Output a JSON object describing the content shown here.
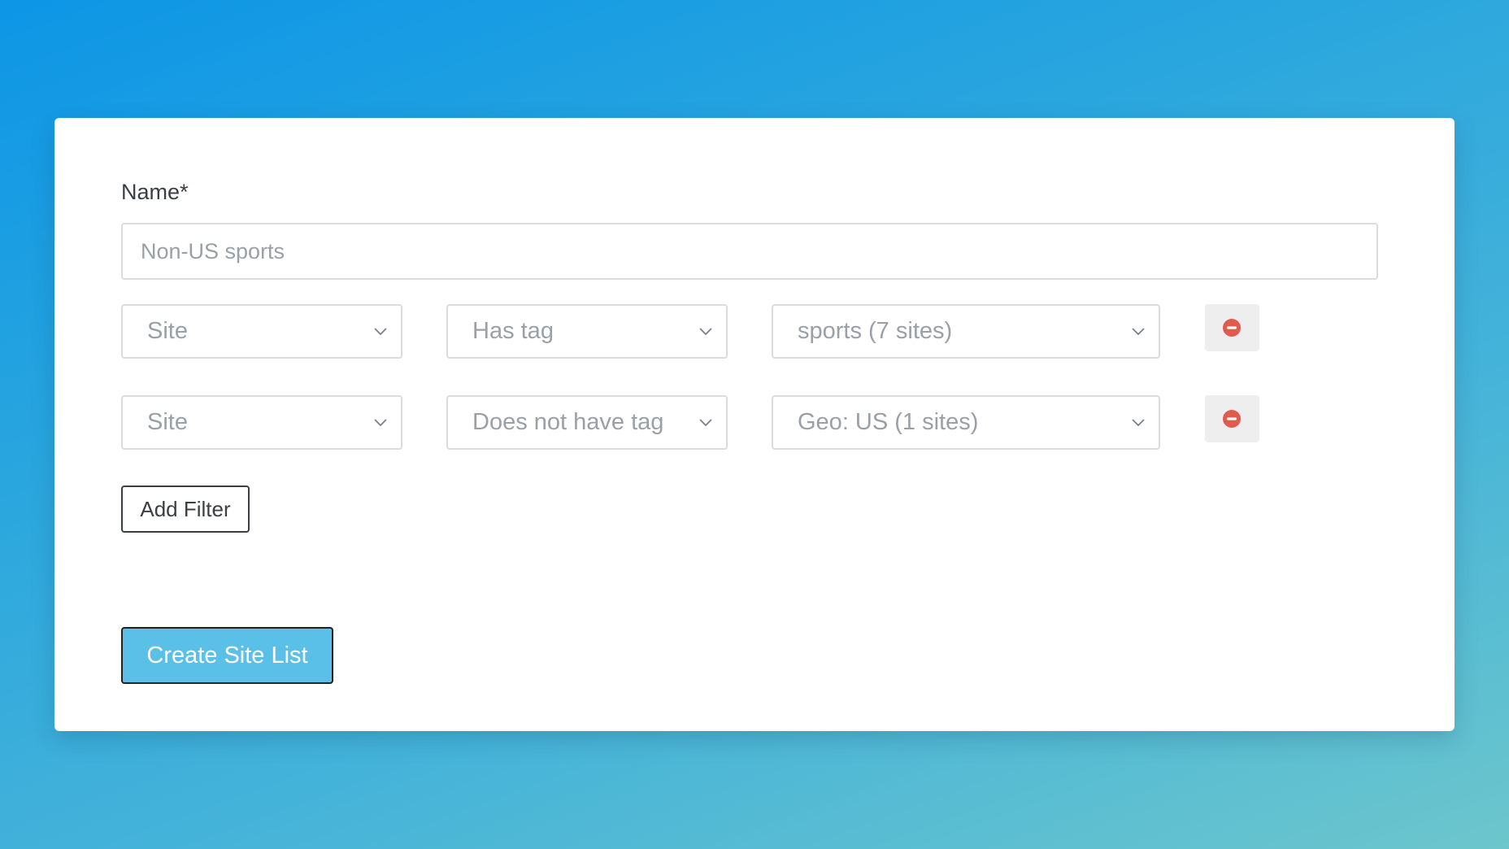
{
  "form": {
    "name_label": "Name*",
    "name_placeholder": "Non-US sports",
    "name_value": ""
  },
  "filters": [
    {
      "field": "Site",
      "operator": "Has tag",
      "tag": "sports (7 sites)"
    },
    {
      "field": "Site",
      "operator": "Does not have tag",
      "tag": "Geo: US (1 sites)"
    }
  ],
  "buttons": {
    "add_filter": "Add Filter",
    "create": "Create Site List"
  },
  "icons": {
    "remove": "minus-circle-icon",
    "dropdown": "chevron-down-icon"
  },
  "colors": {
    "primary_button": "#5bc0e8",
    "remove_icon": "#e05a4e",
    "placeholder_text": "#9aa0a6"
  }
}
